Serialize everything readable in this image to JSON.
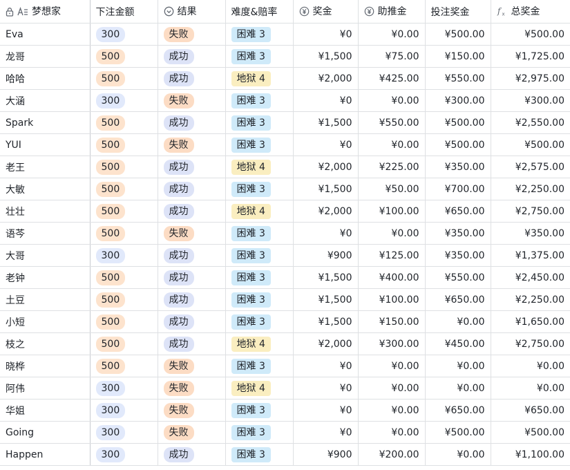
{
  "columns": [
    {
      "label": "梦想家",
      "icon": "text-field-icon"
    },
    {
      "label": "下注金额",
      "icon": ""
    },
    {
      "label": "结果",
      "icon": "single-select-icon"
    },
    {
      "label": "难度&赔率",
      "icon": ""
    },
    {
      "label": "奖金",
      "icon": "currency-icon"
    },
    {
      "label": "助推金",
      "icon": "currency-icon"
    },
    {
      "label": "投注奖金",
      "icon": ""
    },
    {
      "label": "总奖金",
      "icon": "formula-icon"
    }
  ],
  "tag_colors": {
    "bet_300": "#e1e9fb",
    "bet_500": "#fde3cd",
    "result_success": "#dde3f7",
    "result_fail": "#fcdcc4",
    "difficulty_hard": "#cfeaf9",
    "difficulty_hell": "#faeec0"
  },
  "rows": [
    {
      "name": "Eva",
      "bet": "300",
      "result": "失败",
      "difficulty": "困难 3",
      "prize": "¥0",
      "boost": "¥0.00",
      "bet_prize": "¥500.00",
      "total": "¥500.00"
    },
    {
      "name": "龙哥",
      "bet": "500",
      "result": "成功",
      "difficulty": "困难 3",
      "prize": "¥1,500",
      "boost": "¥75.00",
      "bet_prize": "¥150.00",
      "total": "¥1,725.00"
    },
    {
      "name": "哈哈",
      "bet": "500",
      "result": "成功",
      "difficulty": "地狱 4",
      "prize": "¥2,000",
      "boost": "¥425.00",
      "bet_prize": "¥550.00",
      "total": "¥2,975.00"
    },
    {
      "name": "大涵",
      "bet": "300",
      "result": "失败",
      "difficulty": "困难 3",
      "prize": "¥0",
      "boost": "¥0.00",
      "bet_prize": "¥300.00",
      "total": "¥300.00"
    },
    {
      "name": "Spark",
      "bet": "500",
      "result": "成功",
      "difficulty": "困难 3",
      "prize": "¥1,500",
      "boost": "¥550.00",
      "bet_prize": "¥500.00",
      "total": "¥2,550.00"
    },
    {
      "name": "YUI",
      "bet": "500",
      "result": "失败",
      "difficulty": "困难 3",
      "prize": "¥0",
      "boost": "¥0.00",
      "bet_prize": "¥500.00",
      "total": "¥500.00"
    },
    {
      "name": "老王",
      "bet": "500",
      "result": "成功",
      "difficulty": "地狱 4",
      "prize": "¥2,000",
      "boost": "¥225.00",
      "bet_prize": "¥350.00",
      "total": "¥2,575.00"
    },
    {
      "name": "大敏",
      "bet": "500",
      "result": "成功",
      "difficulty": "困难 3",
      "prize": "¥1,500",
      "boost": "¥50.00",
      "bet_prize": "¥700.00",
      "total": "¥2,250.00"
    },
    {
      "name": "壮壮",
      "bet": "500",
      "result": "成功",
      "difficulty": "地狱 4",
      "prize": "¥2,000",
      "boost": "¥100.00",
      "bet_prize": "¥650.00",
      "total": "¥2,750.00"
    },
    {
      "name": "语芩",
      "bet": "500",
      "result": "失败",
      "difficulty": "困难 3",
      "prize": "¥0",
      "boost": "¥0.00",
      "bet_prize": "¥350.00",
      "total": "¥350.00"
    },
    {
      "name": "大哥",
      "bet": "300",
      "result": "成功",
      "difficulty": "困难 3",
      "prize": "¥900",
      "boost": "¥125.00",
      "bet_prize": "¥350.00",
      "total": "¥1,375.00"
    },
    {
      "name": "老钟",
      "bet": "500",
      "result": "成功",
      "difficulty": "困难 3",
      "prize": "¥1,500",
      "boost": "¥400.00",
      "bet_prize": "¥550.00",
      "total": "¥2,450.00"
    },
    {
      "name": "土豆",
      "bet": "500",
      "result": "成功",
      "difficulty": "困难 3",
      "prize": "¥1,500",
      "boost": "¥100.00",
      "bet_prize": "¥650.00",
      "total": "¥2,250.00"
    },
    {
      "name": "小短",
      "bet": "500",
      "result": "成功",
      "difficulty": "困难 3",
      "prize": "¥1,500",
      "boost": "¥150.00",
      "bet_prize": "¥0.00",
      "total": "¥1,650.00"
    },
    {
      "name": "枝之",
      "bet": "500",
      "result": "成功",
      "difficulty": "地狱 4",
      "prize": "¥2,000",
      "boost": "¥300.00",
      "bet_prize": "¥450.00",
      "total": "¥2,750.00"
    },
    {
      "name": "晓桦",
      "bet": "500",
      "result": "失败",
      "difficulty": "困难 3",
      "prize": "¥0",
      "boost": "¥0.00",
      "bet_prize": "¥0.00",
      "total": "¥0.00"
    },
    {
      "name": "阿伟",
      "bet": "300",
      "result": "失败",
      "difficulty": "地狱 4",
      "prize": "¥0",
      "boost": "¥0.00",
      "bet_prize": "¥0.00",
      "total": "¥0.00"
    },
    {
      "name": "华姐",
      "bet": "300",
      "result": "失败",
      "difficulty": "困难 3",
      "prize": "¥0",
      "boost": "¥0.00",
      "bet_prize": "¥650.00",
      "total": "¥650.00"
    },
    {
      "name": "Going",
      "bet": "300",
      "result": "失败",
      "difficulty": "困难 3",
      "prize": "¥0",
      "boost": "¥0.00",
      "bet_prize": "¥500.00",
      "total": "¥500.00"
    },
    {
      "name": "Happen",
      "bet": "300",
      "result": "成功",
      "difficulty": "困难 3",
      "prize": "¥900",
      "boost": "¥200.00",
      "bet_prize": "¥0.00",
      "total": "¥1,100.00"
    }
  ]
}
